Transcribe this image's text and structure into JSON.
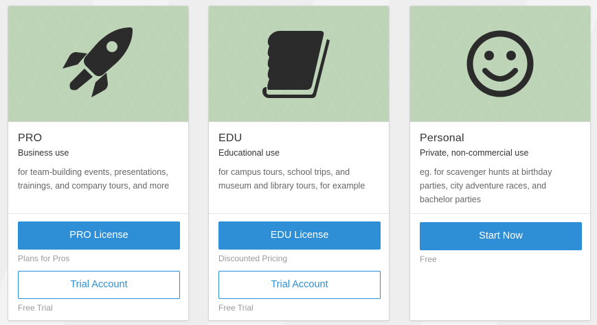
{
  "cards": [
    {
      "icon": "rocket-icon",
      "title": "PRO",
      "subtitle": "Business use",
      "description": "for team-building events, presentations, trainings, and company tours, and more",
      "primary_button": "PRO License",
      "primary_note": "Plans for Pros",
      "secondary_button": "Trial Account",
      "secondary_note": "Free Trial"
    },
    {
      "icon": "book-icon",
      "title": "EDU",
      "subtitle": "Educational use",
      "description": "for campus tours, school trips, and museum and library tours, for example",
      "primary_button": "EDU License",
      "primary_note": "Discounted Pricing",
      "secondary_button": "Trial Account",
      "secondary_note": "Free Trial"
    },
    {
      "icon": "smiley-icon",
      "title": "Personal",
      "subtitle": "Private, non-commercial use",
      "description": "eg. for scavenger hunts at birthday parties, city adventure races, and bachelor parties",
      "primary_button": "Start Now",
      "primary_note": "Free"
    }
  ],
  "colors": {
    "hero_background": "#bed4b6",
    "icon": "#2b2b2b",
    "button_primary": "#2f8fd6",
    "note_text": "#9a9a9a"
  }
}
